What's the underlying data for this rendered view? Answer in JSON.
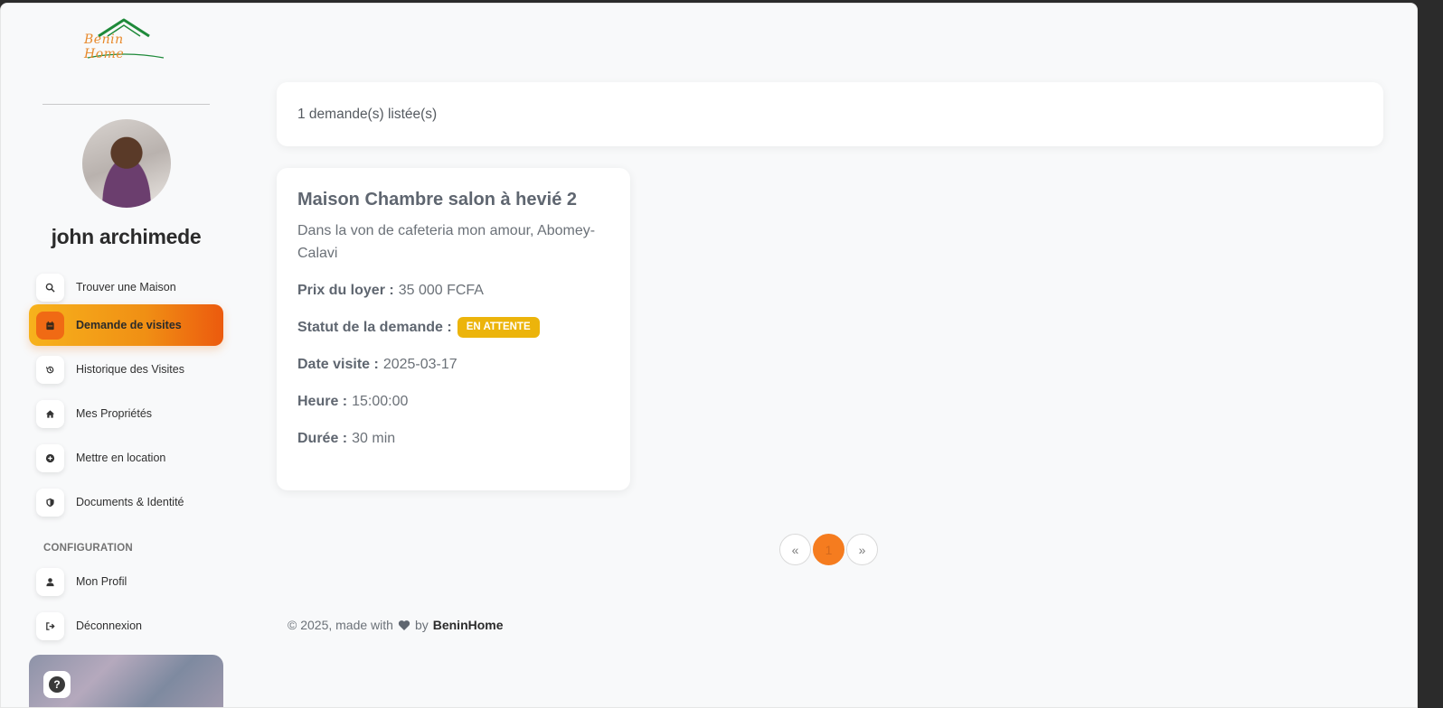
{
  "brand": {
    "logo_text": "Benin Home",
    "accent_color": "#f08f14"
  },
  "user": {
    "name": "john archimede"
  },
  "sidebar": {
    "items": [
      {
        "label": "Trouver une Maison",
        "icon": "search-icon"
      },
      {
        "label": "Demande de visites",
        "icon": "calendar-icon",
        "active": true
      },
      {
        "label": "Historique des Visites",
        "icon": "history-icon"
      },
      {
        "label": "Mes Propriétés",
        "icon": "home-icon"
      },
      {
        "label": "Mettre en location",
        "icon": "plus-circle-icon"
      },
      {
        "label": "Documents & Identité",
        "icon": "shield-icon"
      }
    ],
    "config_title": "CONFIGURATION",
    "config_items": [
      {
        "label": "Mon Profil",
        "icon": "user-icon"
      },
      {
        "label": "Déconnexion",
        "icon": "logout-icon"
      }
    ],
    "help_icon": "?"
  },
  "main": {
    "count_text": "1 demande(s) listée(s)",
    "visit": {
      "title": "Maison Chambre salon à hevié 2",
      "address": "Dans la von de cafeteria mon amour, Abomey-Calavi",
      "rent_label": "Prix du loyer :",
      "rent_value": "35 000 FCFA",
      "status_label": "Statut de la demande :",
      "status_value": "EN ATTENTE",
      "status_color": "#ecb40b",
      "date_label": "Date visite :",
      "date_value": "2025-03-17",
      "time_label": "Heure :",
      "time_value": "15:00:00",
      "duration_label": "Durée :",
      "duration_value": "30 min"
    },
    "pagination": {
      "prev": "«",
      "current": "1",
      "next": "»"
    }
  },
  "footer": {
    "prefix": "© 2025, made with",
    "by": "by",
    "brand": "BeninHome"
  }
}
